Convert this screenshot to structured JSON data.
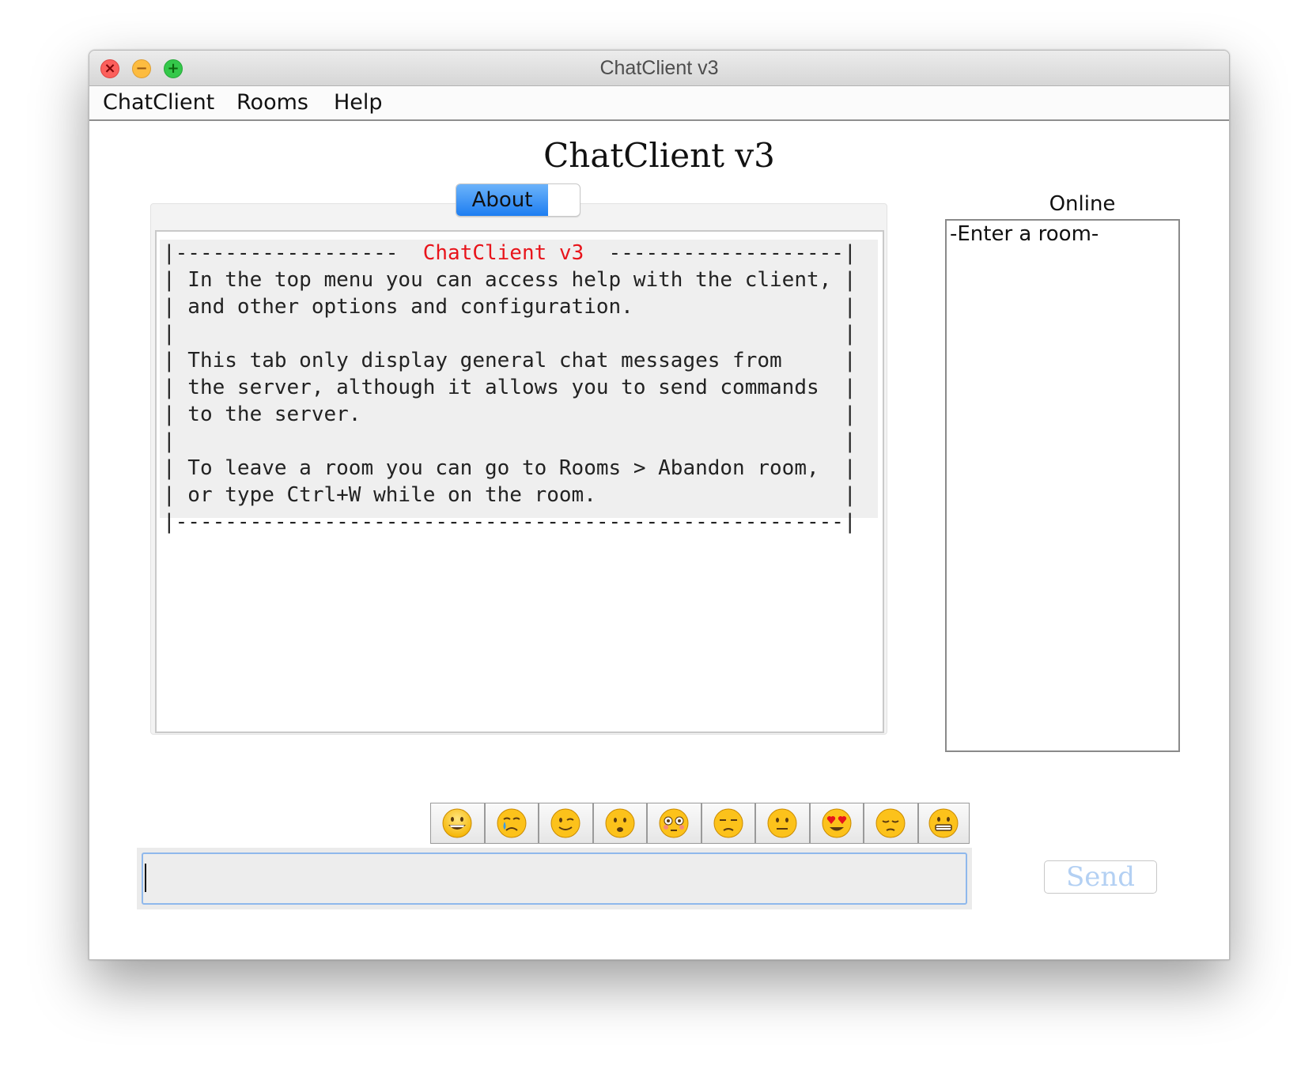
{
  "window": {
    "title": "ChatClient v3"
  },
  "menu": {
    "items": [
      {
        "label": "ChatClient"
      },
      {
        "label": "Rooms"
      },
      {
        "label": "Help"
      }
    ]
  },
  "heading": "ChatClient v3",
  "tabs": [
    {
      "label": "About",
      "selected": true
    }
  ],
  "about_banner": {
    "top_left": "|------------------  ",
    "title": "ChatClient v3",
    "top_right": "  -------------------|",
    "lines": [
      "| In the top menu you can access help with the client, |",
      "| and other options and configuration.                 |",
      "|                                                      |",
      "| This tab only display general chat messages from     |",
      "| the server, although it allows you to send commands  |",
      "| to the server.                                       |",
      "|                                                      |",
      "| To leave a room you can go to Rooms > Abandon room,  |",
      "| or type Ctrl+W while on the room.                    |",
      "|------------------------------------------------------|"
    ],
    "title_color": "#e8141b"
  },
  "online": {
    "label": "Online",
    "items": [
      "-Enter a room-"
    ]
  },
  "emoji_buttons": [
    {
      "icon": "grinning-face-icon"
    },
    {
      "icon": "crying-face-icon"
    },
    {
      "icon": "winking-face-icon"
    },
    {
      "icon": "anguished-face-icon"
    },
    {
      "icon": "flushed-face-icon"
    },
    {
      "icon": "unamused-face-icon"
    },
    {
      "icon": "neutral-face-icon"
    },
    {
      "icon": "heart-eyes-face-icon"
    },
    {
      "icon": "pensive-face-icon"
    },
    {
      "icon": "grimacing-face-icon"
    }
  ],
  "message_input": {
    "value": "",
    "placeholder": ""
  },
  "send_button": {
    "label": "Send",
    "enabled": false
  },
  "colors": {
    "tab_active": "#2f8af5",
    "send_disabled_text": "#b3d0f3",
    "input_focus_border": "#8fb8ec"
  }
}
